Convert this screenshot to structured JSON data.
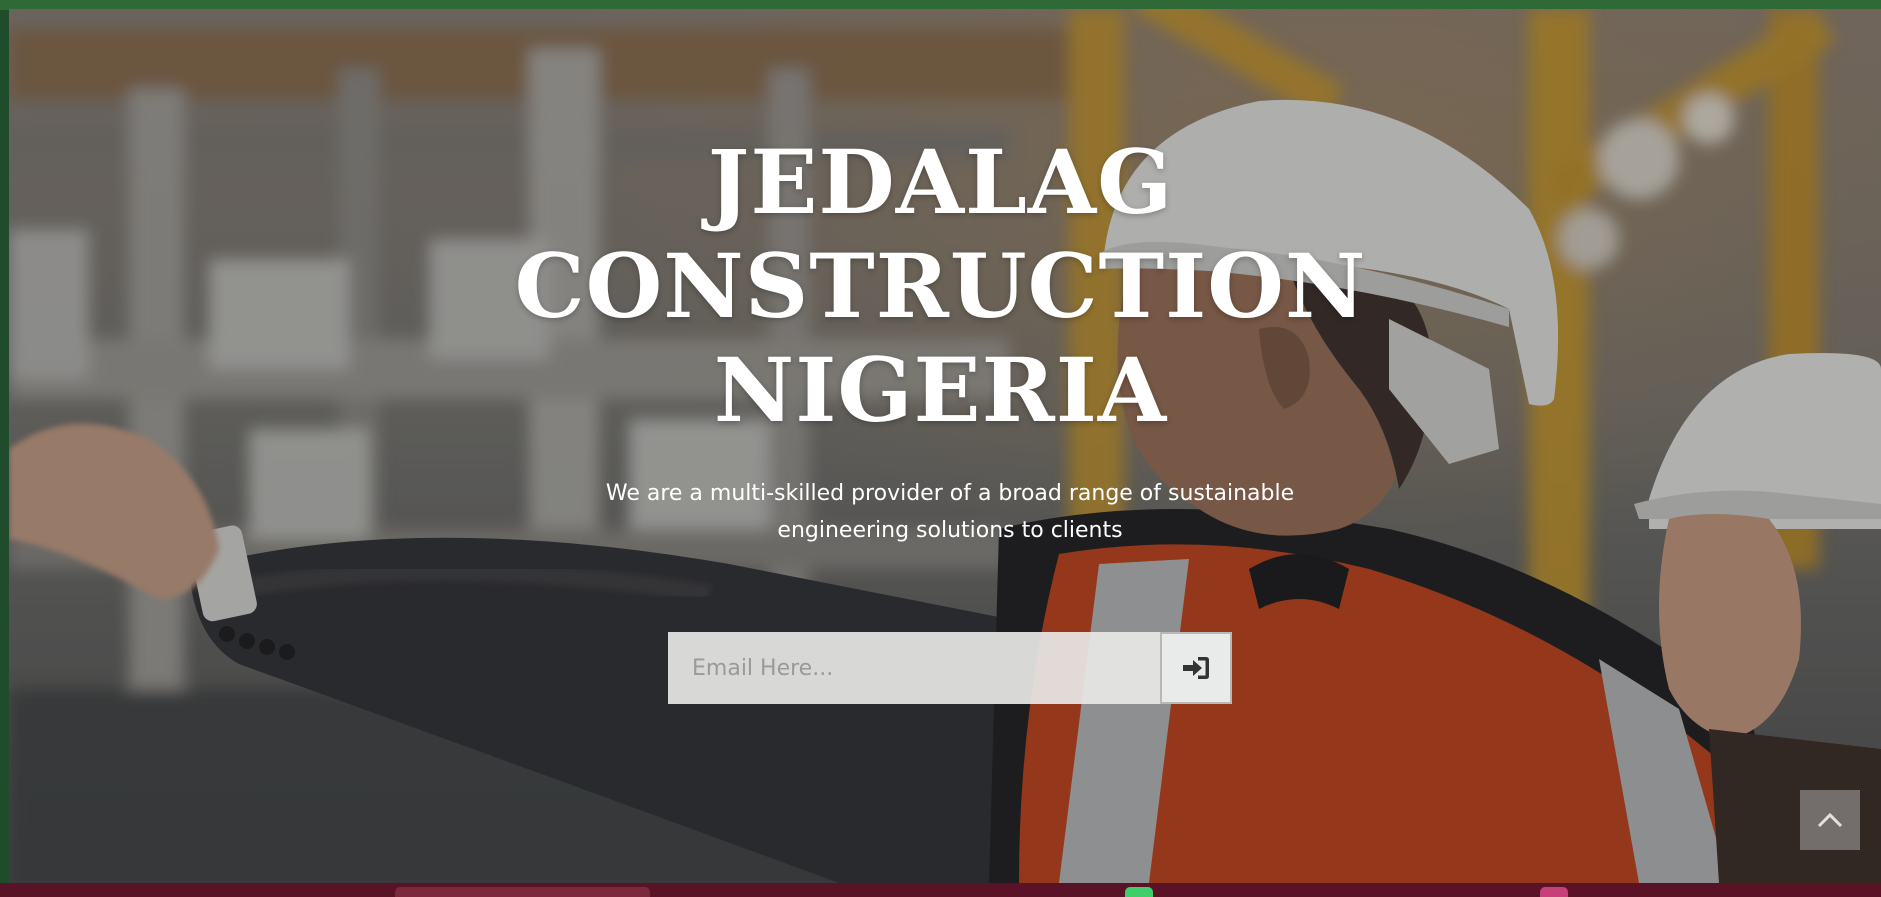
{
  "hero": {
    "title_lines": [
      "JEDALAG",
      "CONSTRUCTION",
      "NIGERIA"
    ],
    "tagline_lines": [
      "We are a multi-skilled provider of a broad range of sustainable",
      "engineering solutions to clients"
    ]
  },
  "signup": {
    "email_placeholder": "Email Here...",
    "submit_icon": "sign-in-icon"
  },
  "back_to_top": {
    "icon": "chevron-up-icon"
  },
  "colors": {
    "top_strip": "#2f6a36",
    "bottom_strip": "#5a1326",
    "vest_orange": "#c4421a",
    "helmet_white": "#e6e6e4",
    "scaffold_yellow": "#c99a2a"
  }
}
